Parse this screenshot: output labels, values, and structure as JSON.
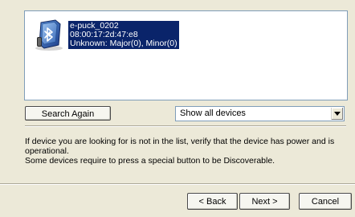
{
  "device_list": {
    "items": [
      {
        "name": "e-puck_0202",
        "address": "08:00:17:2d:47:e8",
        "class": "Unknown: Major(0), Minor(0)",
        "icon": "bluetooth-device-icon"
      }
    ]
  },
  "actions": {
    "search_again_label": "Search Again",
    "filter_selected": "Show all devices"
  },
  "info": {
    "line1": "If device you are looking for is not in the list, verify that the device has power and is operational.",
    "line2": "Some devices require to press a special button to be Discoverable."
  },
  "navigation": {
    "back_label": "< Back",
    "next_label": "Next >",
    "cancel_label": "Cancel"
  },
  "colors": {
    "selection_bg": "#0a246a",
    "window_bg": "#ece9d8",
    "border": "#7f9db9"
  }
}
